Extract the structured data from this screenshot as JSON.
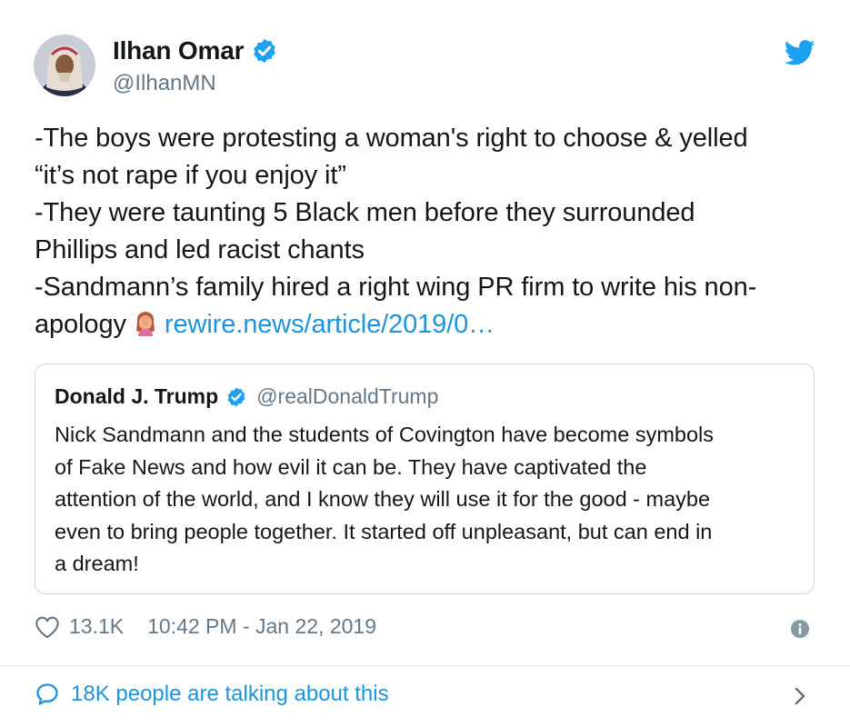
{
  "tweet": {
    "author": {
      "name": "Ilhan Omar",
      "handle": "@IlhanMN"
    },
    "text_lines": [
      "-The boys were protesting a woman's right to choose & yelled",
      "“it’s not rape if you enjoy it”",
      "-They were taunting 5 Black men before they surrounded",
      "Phillips and led racist chants",
      "-Sandmann’s family hired a right wing PR firm to write his non-",
      "apology"
    ],
    "link": "rewire.news/article/2019/0…",
    "likes": "13.1K",
    "timestamp": "10:42 PM - Jan 22, 2019",
    "talking": "18K people are talking about this"
  },
  "quoted": {
    "name": "Donald J. Trump",
    "handle": "@realDonaldTrump",
    "text_lines": [
      "Nick Sandmann and the students of Covington have become symbols",
      "of Fake News and how evil it can be. They have captivated the",
      "attention of the world, and I know they will use it for the good - maybe",
      "even to bring people together. It started off unpleasant, but can end in",
      "a dream!"
    ]
  },
  "icons": {
    "verified": "verified-badge-icon",
    "brand": "twitter-bird-icon",
    "emoji": "facepalm-emoji-icon",
    "like": "heart-icon",
    "info": "info-icon",
    "reply": "speech-bubble-icon",
    "chevron": "chevron-right-icon"
  },
  "colors": {
    "brand_blue": "#1da1f2",
    "link_blue": "#1b95e0",
    "secondary_text": "#657786"
  }
}
